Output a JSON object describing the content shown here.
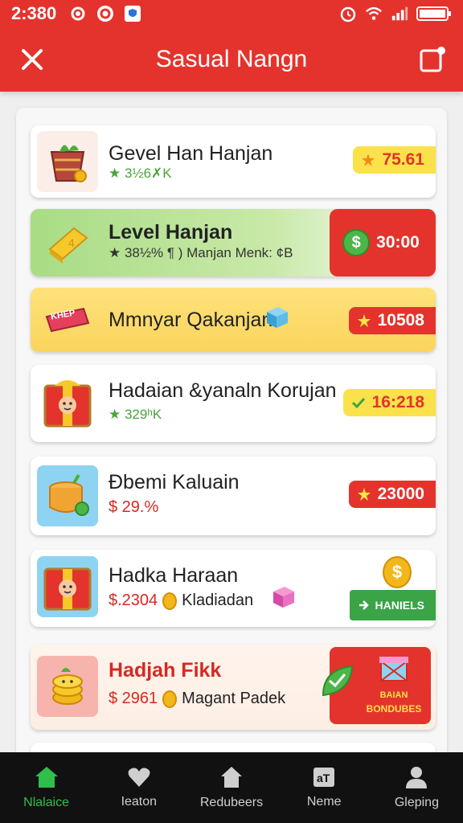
{
  "status": {
    "time": "2:380"
  },
  "header": {
    "title": "Sasual Nangn"
  },
  "cards": [
    {
      "title": "Gevel Han Hanjan",
      "sub": "★ 3½6✗K",
      "badge": "75.61"
    },
    {
      "title": "Level Hanjan",
      "sub": "★ 38½% ¶ ) Manjan Menk: ¢Β",
      "badge": "30:00"
    },
    {
      "title": "Mmnyar Qakanjan",
      "badge": "10508",
      "tag": "KHEP"
    },
    {
      "title": "Hadaian &yanaln Korujan",
      "sub": "★ 329ʰK",
      "badge": "16:218"
    },
    {
      "title": "Ðbemi Kaluain",
      "sub": "$ 29.%",
      "badge": "23000"
    },
    {
      "title": "Hadka Haraan",
      "sub_price": "$.2304",
      "sub_text": "Kladiadan",
      "badge": "HANIELS",
      "badge_small": "HANIELS"
    },
    {
      "title": "Hadjah Fikk",
      "sub_price": "$ 2961",
      "sub_text": "Magant Padek",
      "badge_line1": "BAIAN",
      "badge_line2": "BONDUBES"
    }
  ],
  "nav": [
    {
      "label": "Nlalaice",
      "icon": "home-icon"
    },
    {
      "label": "Ieaton",
      "icon": "heart-icon"
    },
    {
      "label": "Redubeers",
      "icon": "house-icon"
    },
    {
      "label": "Neme",
      "icon": "card-icon"
    },
    {
      "label": "Gleping",
      "icon": "person-icon"
    }
  ],
  "colors": {
    "brand": "#e4332c",
    "accent_yellow": "#fbe24a",
    "active_nav": "#2fbf4a"
  }
}
